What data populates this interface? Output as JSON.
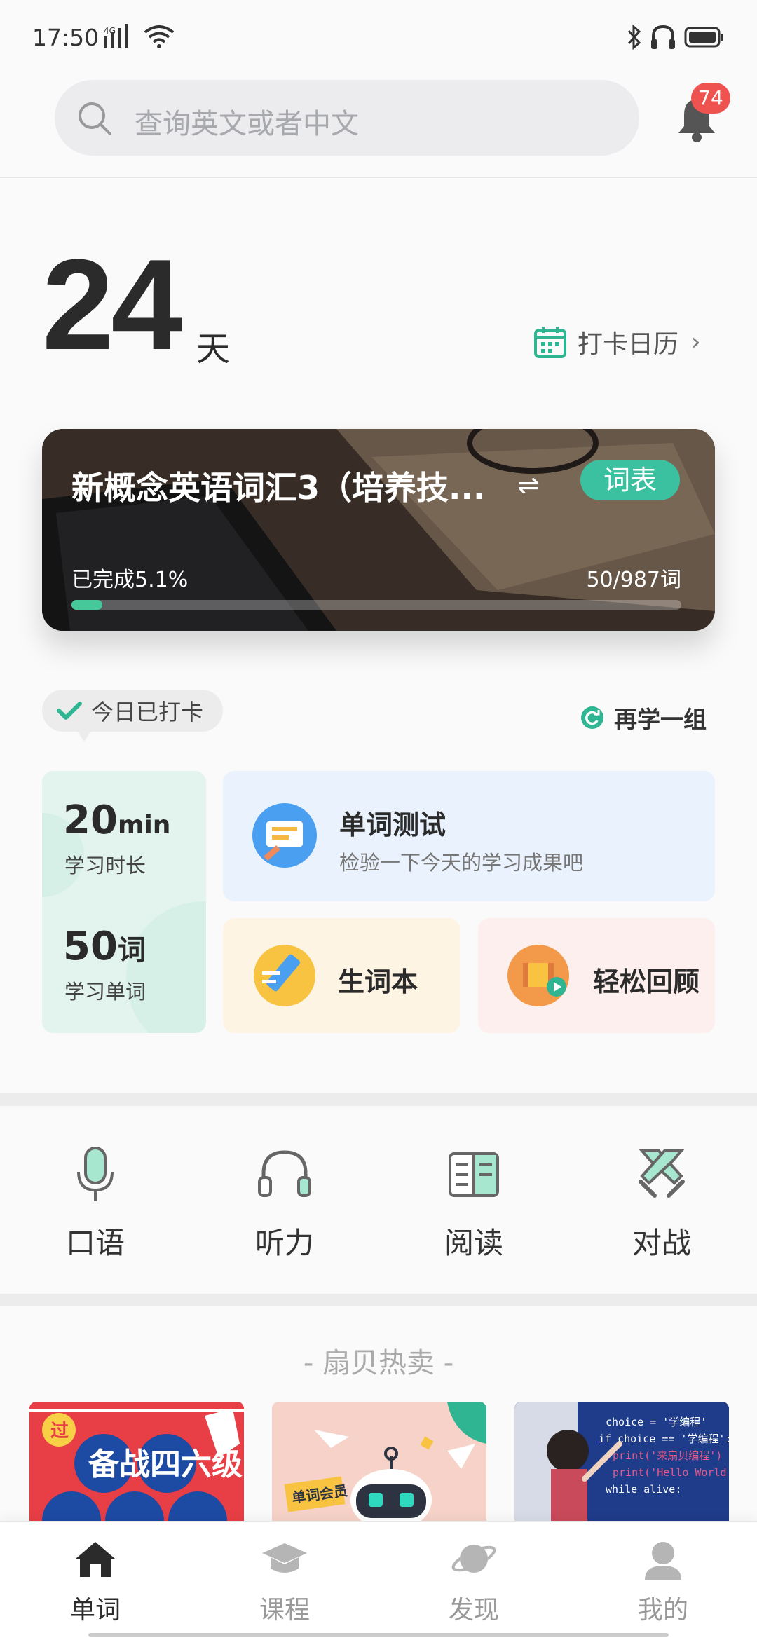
{
  "status_bar": {
    "time": "17:50",
    "network": "4G"
  },
  "search": {
    "placeholder": "查询英文或者中文",
    "notification_count": "74"
  },
  "streak": {
    "days": "24",
    "unit": "天",
    "calendar_label": "打卡日历"
  },
  "current_book": {
    "title": "新概念英语词汇3（培养技...",
    "swap_glyph": "⇌",
    "tag": "词表",
    "progress_label": "已完成5.1%",
    "progress_fraction": 0.051,
    "count": "50/987词"
  },
  "checkin": {
    "status": "今日已打卡",
    "again": "再学一组"
  },
  "stats": {
    "duration_value": "20",
    "duration_unit": "min",
    "duration_label": "学习时长",
    "words_value": "50",
    "words_unit": "词",
    "words_label": "学习单词"
  },
  "cards": {
    "test_title": "单词测试",
    "test_subtitle": "检验一下今天的学习成果吧",
    "vocab_title": "生词本",
    "review_title": "轻松回顾"
  },
  "features": [
    "口语",
    "听力",
    "阅读",
    "对战"
  ],
  "hot_section_title": "- 扇贝热卖 -",
  "products": [
    {
      "text": "备战四六级",
      "badge": "过"
    },
    {
      "text": "单词会员"
    },
    {
      "code": [
        "choice = '学编程'",
        "if choice == '学编程':",
        "print('来扇贝编程')",
        "print('Hello World')",
        "while alive:"
      ]
    }
  ],
  "tabs": [
    "单词",
    "课程",
    "发现",
    "我的"
  ],
  "colors": {
    "accent": "#3bc0a0",
    "badge_red": "#ef5350",
    "progress": "#46c89b"
  }
}
